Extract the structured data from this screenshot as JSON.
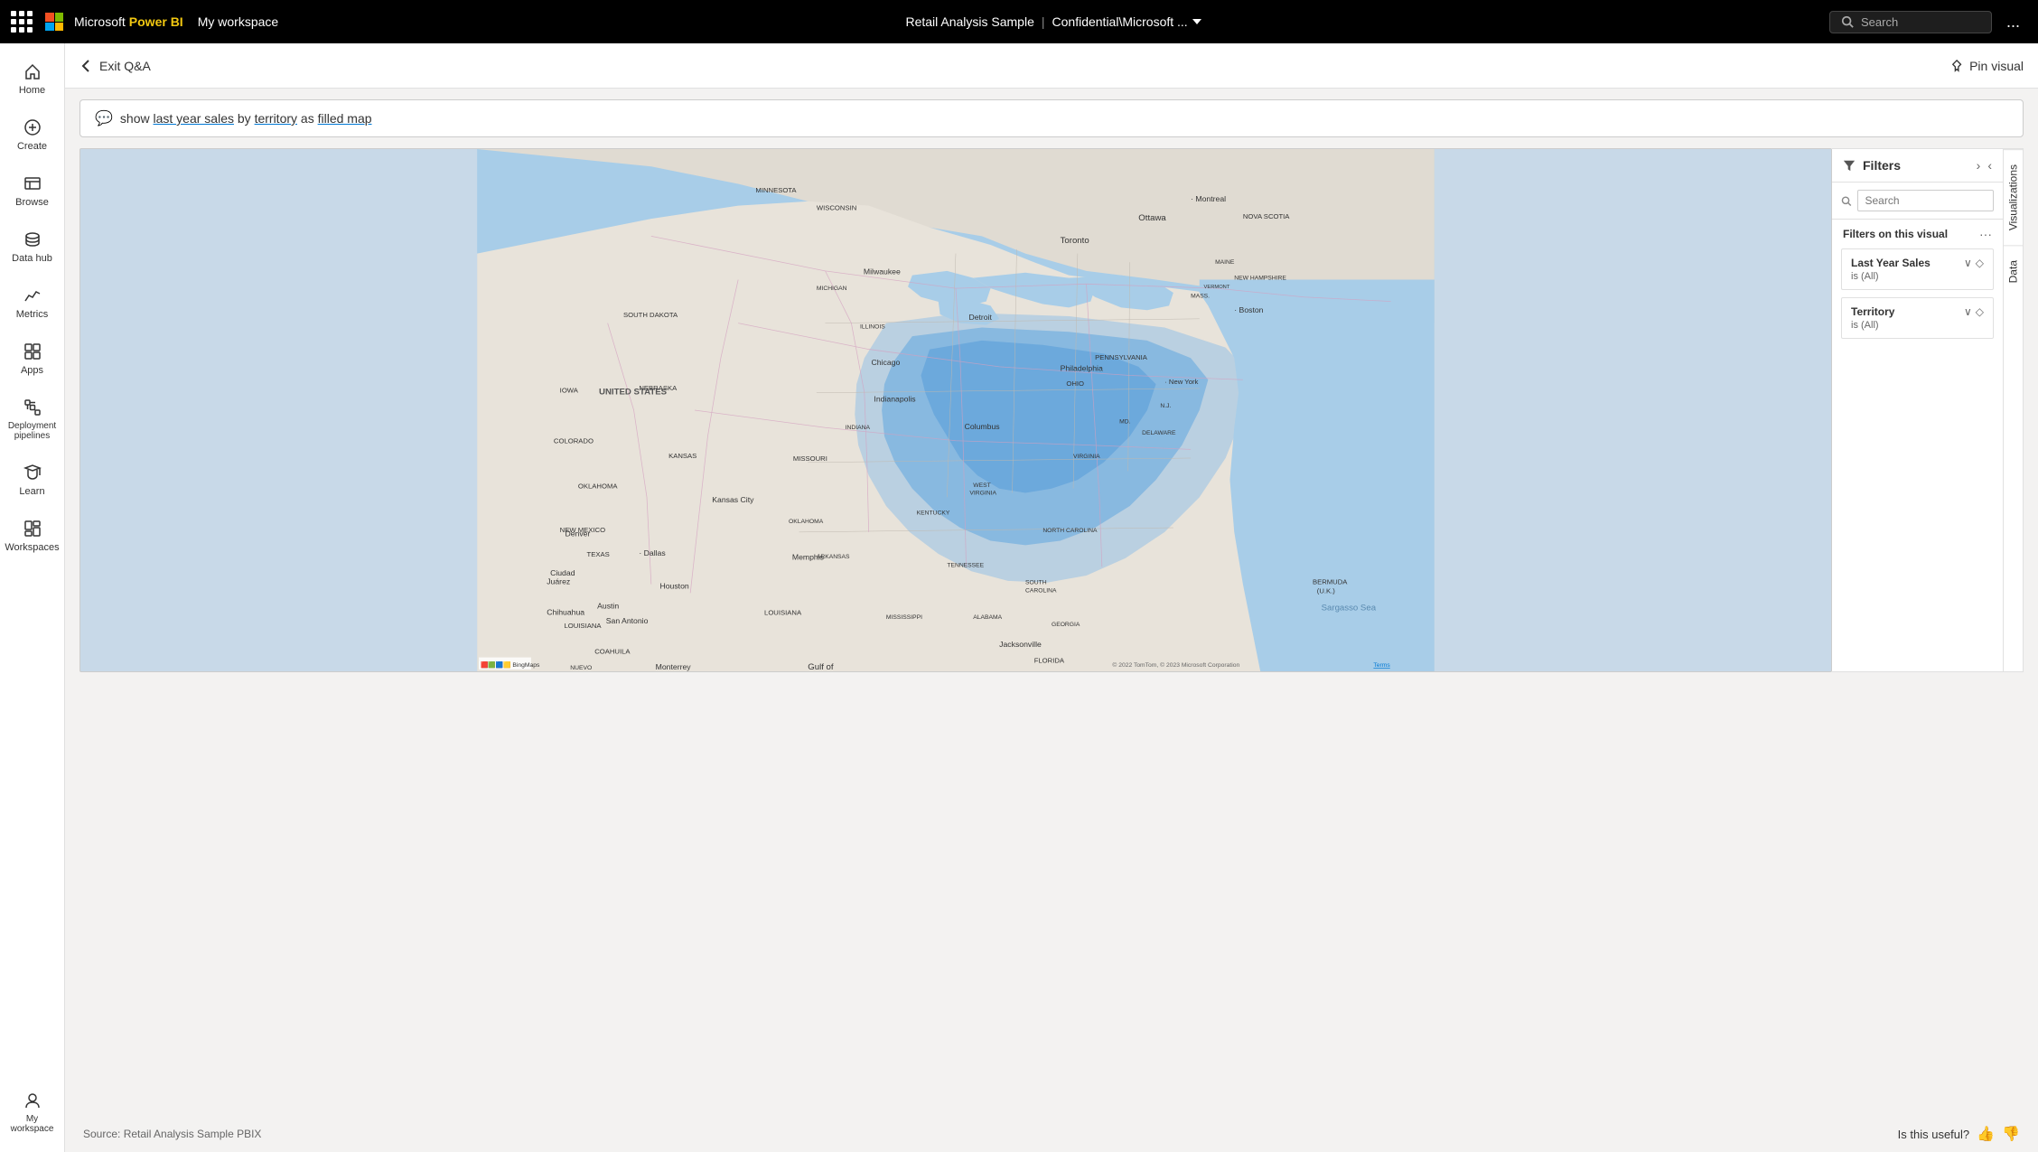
{
  "topnav": {
    "grid_icon_label": "Grid menu",
    "microsoft_label": "Microsoft",
    "powerbi_label": "Power BI",
    "workspace_label": "My workspace",
    "report_title": "Retail Analysis Sample",
    "report_subtitle": "Confidential\\Microsoft ...",
    "search_placeholder": "Search",
    "more_label": "..."
  },
  "header": {
    "back_label": "Exit Q&A",
    "pin_label": "Pin visual"
  },
  "qa": {
    "query_prefix": "show ",
    "query_highlight1": "last year sales",
    "query_by": " by ",
    "query_highlight2": "territory",
    "query_as": " as ",
    "query_highlight3": "filled map"
  },
  "filters": {
    "title": "Filters",
    "search_placeholder": "Search",
    "section_title": "Filters on this visual",
    "filter1": {
      "name": "Last Year Sales",
      "condition": "is (All)"
    },
    "filter2": {
      "name": "Territory",
      "condition": "is (All)"
    }
  },
  "side_tabs": {
    "tab1": "Visualizations",
    "tab2": "Data"
  },
  "bottom": {
    "source_text": "Source: Retail Analysis Sample PBIX",
    "useful_label": "Is this useful?"
  },
  "sidebar": {
    "items": [
      {
        "id": "home",
        "label": "Home"
      },
      {
        "id": "create",
        "label": "Create"
      },
      {
        "id": "browse",
        "label": "Browse"
      },
      {
        "id": "datahub",
        "label": "Data hub"
      },
      {
        "id": "metrics",
        "label": "Metrics"
      },
      {
        "id": "apps",
        "label": "Apps"
      },
      {
        "id": "deployment",
        "label": "Deployment pipelines"
      },
      {
        "id": "learn",
        "label": "Learn"
      },
      {
        "id": "workspaces",
        "label": "Workspaces"
      },
      {
        "id": "myworkspace",
        "label": "My workspace"
      }
    ]
  },
  "map": {
    "copyright": "© 2022 TomTom, © 2023 Microsoft Corporation",
    "terms": "Terms",
    "bermuda_label": "BERMUDA (U.K.)",
    "sargasso_label": "Sargasso Sea",
    "gulf_label": "Gulf of"
  },
  "colors": {
    "accent": "#0078d4",
    "nav_bg": "#000000",
    "sidebar_bg": "#ffffff",
    "map_water": "#a8cde8",
    "map_land": "#e8e4de",
    "map_highlight_dark": "#1a6fbd",
    "map_highlight_mid": "#5ba0d8",
    "map_highlight_light": "#a8cde8"
  }
}
